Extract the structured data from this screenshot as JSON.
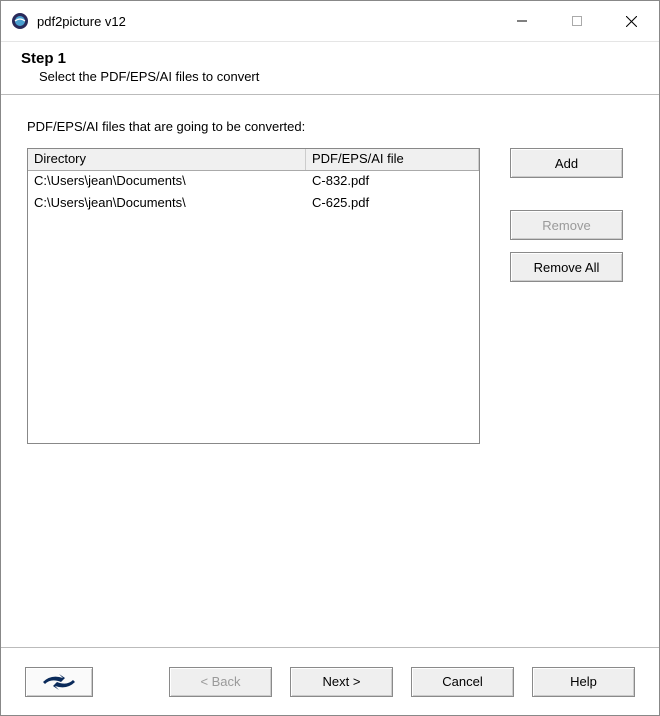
{
  "window": {
    "title": "pdf2picture v12"
  },
  "step": {
    "title": "Step 1",
    "subtitle": "Select the PDF/EPS/AI files to convert"
  },
  "filesLabel": "PDF/EPS/AI files that are going to be converted:",
  "columns": {
    "directory": "Directory",
    "file": "PDF/EPS/AI file"
  },
  "rows": [
    {
      "directory": "C:\\Users\\jean\\Documents\\",
      "file": "C-832.pdf"
    },
    {
      "directory": "C:\\Users\\jean\\Documents\\",
      "file": "C-625.pdf"
    }
  ],
  "buttons": {
    "add": "Add",
    "remove": "Remove",
    "removeAll": "Remove All",
    "back": "< Back",
    "next": "Next >",
    "cancel": "Cancel",
    "help": "Help"
  }
}
